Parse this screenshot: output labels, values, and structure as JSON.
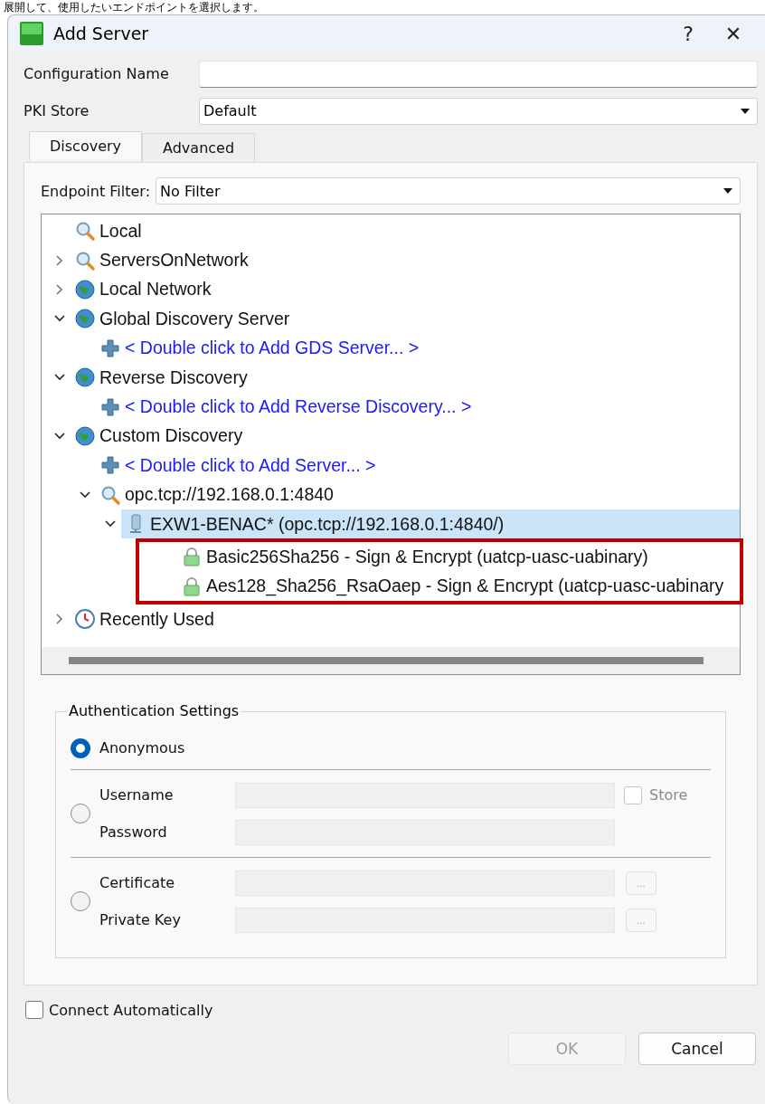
{
  "caption": "展開して、使用したいエンドポイントを選択します。",
  "window": {
    "title": "Add Server",
    "help": "?",
    "close": "✕"
  },
  "form": [
    {
      "label": "Configuration Name",
      "kind": "text"
    },
    {
      "label": "PKI Store",
      "kind": "select",
      "value": "Default"
    }
  ],
  "tabs": [
    {
      "label": "Discovery",
      "selected": true
    },
    {
      "label": "Advanced",
      "selected": false
    }
  ],
  "endpoint_filter": {
    "label": "Endpoint Filter:",
    "value": "No Filter"
  },
  "tree": [
    {
      "label": "Local",
      "kind": "query",
      "selected": false
    },
    {
      "label": "ServersOnNetwork",
      "kind": "query",
      "expanded": false,
      "selected": false
    },
    {
      "label": "Local Network",
      "kind": "network",
      "expanded": false,
      "selected": false
    },
    {
      "label": "Global Discovery Server",
      "kind": "network",
      "expanded": true,
      "selected": false,
      "children": [
        {
          "label": "< Double click to Add GDS Server... >",
          "kind": "action",
          "selected": false
        }
      ]
    },
    {
      "label": "Reverse Discovery",
      "kind": "network",
      "expanded": true,
      "selected": false,
      "children": [
        {
          "label": "< Double click to Add Reverse Discovery... >",
          "kind": "action",
          "selected": false
        }
      ]
    },
    {
      "label": "Custom Discovery",
      "kind": "network",
      "expanded": true,
      "selected": false,
      "children": [
        {
          "label": "< Double click to Add Server... >",
          "kind": "action",
          "selected": false
        },
        {
          "label": "opc.tcp://192.168.0.1:4840",
          "kind": "query",
          "expanded": true,
          "selected": false,
          "children": [
            {
              "label": "EXW1-BENAC* (opc.tcp://192.168.0.1:4840/)",
              "kind": "server",
              "expanded": true,
              "selected": true,
              "highlighted": true,
              "children": [
                {
                  "label": "Basic256Sha256 - Sign & Encrypt (uatcp-uasc-uabinary)",
                  "kind": "endpoint",
                  "selected": false
                },
                {
                  "label": "Aes128_Sha256_RsaOaep - Sign & Encrypt (uatcp-uasc-uabinary",
                  "kind": "endpoint",
                  "selected": false
                }
              ]
            }
          ]
        }
      ]
    },
    {
      "label": "Recently Used",
      "kind": "history",
      "expanded": false,
      "selected": false
    }
  ],
  "auth": {
    "title": "Authentication Settings",
    "groups": [
      {
        "selected": true,
        "rows": [
          {
            "label": "Anonymous",
            "kind": "option"
          }
        ]
      },
      {
        "selected": false,
        "rows": [
          {
            "label": "Username",
            "kind": "input",
            "extra": {
              "kind": "checkbox",
              "label": "Store",
              "checked": false
            }
          },
          {
            "label": "Password",
            "kind": "input"
          }
        ]
      },
      {
        "selected": false,
        "rows": [
          {
            "label": "Certificate",
            "kind": "input",
            "extra": {
              "kind": "browse",
              "label": "..."
            }
          },
          {
            "label": "Private Key",
            "kind": "input",
            "extra": {
              "kind": "browse",
              "label": "..."
            }
          }
        ]
      }
    ]
  },
  "connect_automatically": {
    "label": "Connect Automatically",
    "checked": false
  },
  "buttons": [
    {
      "label": "OK",
      "disabled": true
    },
    {
      "label": "Cancel",
      "disabled": false
    }
  ]
}
